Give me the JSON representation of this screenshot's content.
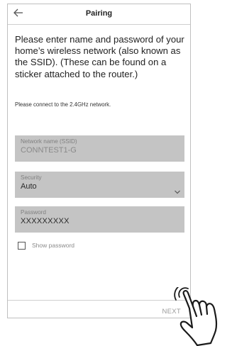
{
  "header": {
    "title": "Pairing",
    "back_icon": "back-arrow-icon"
  },
  "intro_text": "Please enter name and password of your home’s wireless network (also known as the SSID). (These can be found on a sticker attached to the router.)",
  "note_text": "Please connect to the 2.4GHz network.",
  "fields": {
    "ssid": {
      "label": "Network name (SSID)",
      "value": "CONNTEST1-G"
    },
    "security": {
      "label": "Security",
      "value": "Auto",
      "icon": "chevron-down-icon"
    },
    "password": {
      "label": "Password",
      "value": "XXXXXXXXX"
    }
  },
  "show_password": {
    "label": "Show password",
    "checked": false
  },
  "footer": {
    "next_label": "NEXT"
  },
  "pointer": {
    "icon": "tapping-hand-icon"
  },
  "colors": {
    "field_bg": "#c4c4c4",
    "border": "#bfbfbf",
    "muted_text": "#9a9a9a"
  }
}
